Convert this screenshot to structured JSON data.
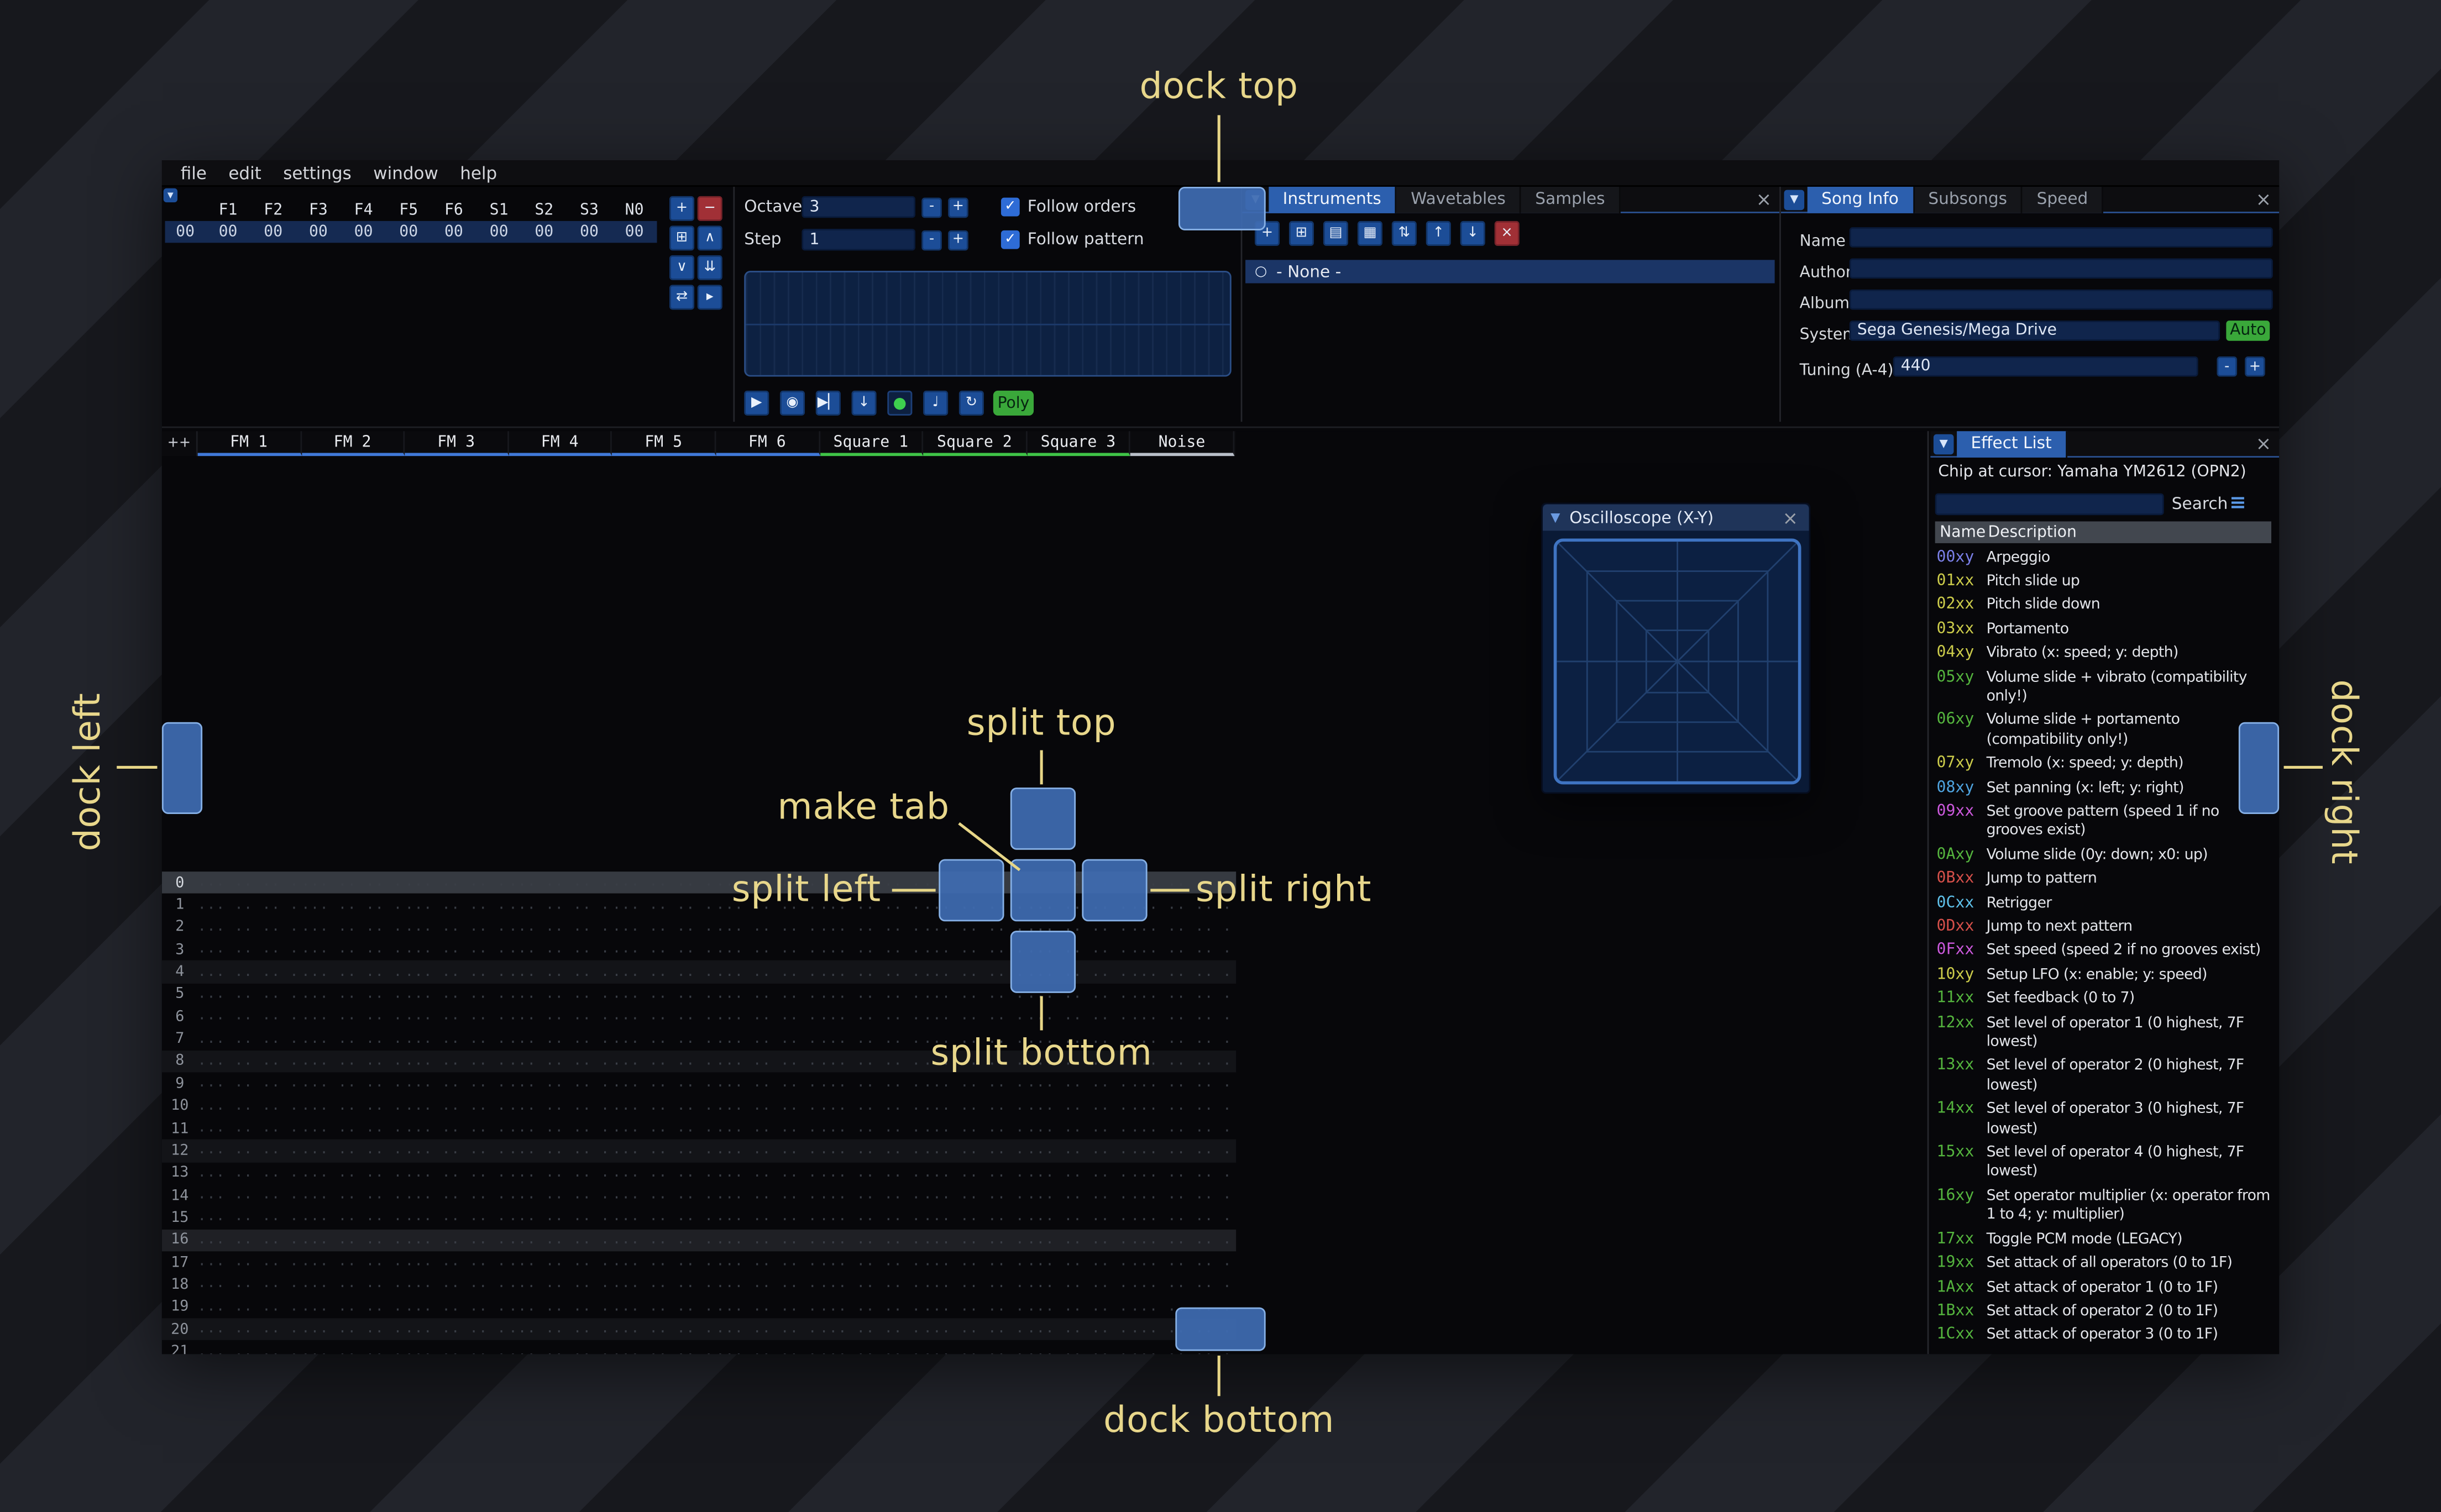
{
  "ui": {
    "minus": "-",
    "plus": "+",
    "check": "✓",
    "collapse": "▼",
    "close": "×",
    "menu": "≡",
    "radio": "○"
  },
  "window": {
    "menu": [
      "file",
      "edit",
      "settings",
      "window",
      "help"
    ]
  },
  "orders": {
    "channel_headers": [
      "F1",
      "F2",
      "F3",
      "F4",
      "F5",
      "F6",
      "S1",
      "S2",
      "S3",
      "N0"
    ],
    "rows": [
      {
        "index": "00",
        "cells": [
          "00",
          "00",
          "00",
          "00",
          "00",
          "00",
          "00",
          "00",
          "00",
          "00"
        ]
      }
    ],
    "buttons": [
      {
        "name": "add-order-button",
        "glyph": "+",
        "style": "blue"
      },
      {
        "name": "remove-order-button",
        "glyph": "−",
        "style": "red"
      },
      {
        "name": "duplicate-order-button",
        "glyph": "⊞",
        "style": "blue"
      },
      {
        "name": "move-order-up-button",
        "glyph": "∧",
        "style": "blue"
      },
      {
        "name": "move-order-down-button",
        "glyph": "∨",
        "style": "blue"
      },
      {
        "name": "deep-clone-order-button",
        "glyph": "⇊",
        "style": "blue"
      },
      {
        "name": "order-change-all-button",
        "glyph": "⇄",
        "style": "blue"
      },
      {
        "name": "order-edit-mode-button",
        "glyph": "▸",
        "style": "blue"
      }
    ]
  },
  "transport": {
    "octave": {
      "label": "Octave",
      "value": "3"
    },
    "step": {
      "label": "Step",
      "value": "1"
    },
    "follow_orders": "Follow orders",
    "follow_pattern": "Follow pattern",
    "poly_label": "Poly",
    "buttons": [
      {
        "name": "play-button",
        "glyph": "▶",
        "style": "blue"
      },
      {
        "name": "play-from-start-button",
        "glyph": "◉",
        "style": "blue"
      },
      {
        "name": "play-one-row-button",
        "glyph": "▶▏",
        "style": "blue"
      },
      {
        "name": "step-row-button",
        "glyph": "↓",
        "style": "blue"
      },
      {
        "name": "record-button",
        "glyph": "●",
        "style": "record"
      },
      {
        "name": "metronome-button",
        "glyph": "♩",
        "style": "blue"
      },
      {
        "name": "repeat-pattern-button",
        "glyph": "↻",
        "style": "blue"
      }
    ]
  },
  "instruments": {
    "tabs": [
      {
        "label": "Instruments",
        "active": true
      },
      {
        "label": "Wavetables",
        "active": false
      },
      {
        "label": "Samples",
        "active": false
      }
    ],
    "toolbar": [
      {
        "name": "add-instrument-button",
        "glyph": "+",
        "style": "blue"
      },
      {
        "name": "duplicate-instrument-button",
        "glyph": "⊞",
        "style": "blue"
      },
      {
        "name": "open-instrument-button",
        "glyph": "▤",
        "style": "blue"
      },
      {
        "name": "save-instrument-button",
        "glyph": "▦",
        "style": "blue"
      },
      {
        "name": "toggle-folders-button",
        "glyph": "⇅",
        "style": "blue"
      },
      {
        "name": "move-instrument-up-button",
        "glyph": "↑",
        "style": "blue"
      },
      {
        "name": "move-instrument-down-button",
        "glyph": "↓",
        "style": "blue"
      },
      {
        "name": "delete-instrument-button",
        "glyph": "×",
        "style": "red"
      }
    ],
    "list": [
      {
        "label": "- None -",
        "selected": true
      }
    ]
  },
  "song_info": {
    "tabs": [
      {
        "label": "Song Info",
        "active": true
      },
      {
        "label": "Subsongs",
        "active": false
      },
      {
        "label": "Speed",
        "active": false
      }
    ],
    "fields": [
      {
        "label": "Name",
        "value": ""
      },
      {
        "label": "Author",
        "value": ""
      },
      {
        "label": "Album",
        "value": ""
      }
    ],
    "system_label": "System",
    "system_value": "Sega Genesis/Mega Drive",
    "auto_label": "Auto",
    "tuning_label": "Tuning (A-4)",
    "tuning_value": "440"
  },
  "pattern": {
    "expand_label": "++",
    "channels": [
      {
        "name": "FM 1",
        "type": "fm"
      },
      {
        "name": "FM 2",
        "type": "fm"
      },
      {
        "name": "FM 3",
        "type": "fm"
      },
      {
        "name": "FM 4",
        "type": "fm"
      },
      {
        "name": "FM 5",
        "type": "fm"
      },
      {
        "name": "FM 6",
        "type": "fm"
      },
      {
        "name": "Square 1",
        "type": "square"
      },
      {
        "name": "Square 2",
        "type": "square"
      },
      {
        "name": "Square 3",
        "type": "square"
      },
      {
        "name": "Noise",
        "type": "noise"
      }
    ],
    "channel_colors": {
      "fm": "#4079d8",
      "square": "#3fc447",
      "noise": "#b9bfc9"
    },
    "visible_rows": 22,
    "current_row": 0,
    "row_highlight_minor": 4,
    "row_highlight_major": 16,
    "cell_placeholder": "... .. .. ...."
  },
  "oscilloscope": {
    "title": "Oscilloscope (X-Y)"
  },
  "effect_list": {
    "tab_label": "Effect List",
    "chip_line": "Chip at cursor: Yamaha YM2612 (OPN2)",
    "search_label": "Search",
    "columns": [
      "Name",
      "Description"
    ],
    "effects": [
      {
        "code": "00xy",
        "color": "#7b80e8",
        "desc": "Arpeggio"
      },
      {
        "code": "01xx",
        "color": "#cdcd4b",
        "desc": "Pitch slide up"
      },
      {
        "code": "02xx",
        "color": "#cdcd4b",
        "desc": "Pitch slide down"
      },
      {
        "code": "03xx",
        "color": "#cdcd4b",
        "desc": "Portamento"
      },
      {
        "code": "04xy",
        "color": "#cdcd4b",
        "desc": "Vibrato (x: speed; y: depth)"
      },
      {
        "code": "05xy",
        "color": "#55b53e",
        "desc": "Volume slide + vibrato (compatibility only!)"
      },
      {
        "code": "06xy",
        "color": "#55b53e",
        "desc": "Volume slide + portamento (compatibility only!)"
      },
      {
        "code": "07xy",
        "color": "#cdcd4b",
        "desc": "Tremolo (x: speed; y: depth)"
      },
      {
        "code": "08xy",
        "color": "#4fa4e0",
        "desc": "Set panning (x: left; y: right)"
      },
      {
        "code": "09xx",
        "color": "#cc59dd",
        "desc": "Set groove pattern (speed 1 if no grooves exist)"
      },
      {
        "code": "0Axy",
        "color": "#55b53e",
        "desc": "Volume slide (0y: down; x0: up)"
      },
      {
        "code": "0Bxx",
        "color": "#d6504a",
        "desc": "Jump to pattern"
      },
      {
        "code": "0Cxx",
        "color": "#5fc1ea",
        "desc": "Retrigger"
      },
      {
        "code": "0Dxx",
        "color": "#d6504a",
        "desc": "Jump to next pattern"
      },
      {
        "code": "0Fxx",
        "color": "#cc59dd",
        "desc": "Set speed (speed 2 if no grooves exist)"
      },
      {
        "code": "10xy",
        "color": "#cdcd4b",
        "desc": "Setup LFO (x: enable; y: speed)"
      },
      {
        "code": "11xx",
        "color": "#55b53e",
        "desc": "Set feedback (0 to 7)"
      },
      {
        "code": "12xx",
        "color": "#55b53e",
        "desc": "Set level of operator 1 (0 highest, 7F lowest)"
      },
      {
        "code": "13xx",
        "color": "#55b53e",
        "desc": "Set level of operator 2 (0 highest, 7F lowest)"
      },
      {
        "code": "14xx",
        "color": "#55b53e",
        "desc": "Set level of operator 3 (0 highest, 7F lowest)"
      },
      {
        "code": "15xx",
        "color": "#55b53e",
        "desc": "Set level of operator 4 (0 highest, 7F lowest)"
      },
      {
        "code": "16xy",
        "color": "#55b53e",
        "desc": "Set operator multiplier (x: operator from 1 to 4; y: multiplier)"
      },
      {
        "code": "17xx",
        "color": "#55b53e",
        "desc": "Toggle PCM mode (LEGACY)"
      },
      {
        "code": "19xx",
        "color": "#55b53e",
        "desc": "Set attack of all operators (0 to 1F)"
      },
      {
        "code": "1Axx",
        "color": "#55b53e",
        "desc": "Set attack of operator 1 (0 to 1F)"
      },
      {
        "code": "1Bxx",
        "color": "#55b53e",
        "desc": "Set attack of operator 2 (0 to 1F)"
      },
      {
        "code": "1Cxx",
        "color": "#55b53e",
        "desc": "Set attack of operator 3 (0 to 1F)"
      }
    ]
  },
  "overlay": {
    "accent_color": "#e8d78b",
    "dock_target_color": "#3e6cb2",
    "labels": {
      "dock_top": "dock top",
      "dock_bottom": "dock bottom",
      "dock_left": "dock left",
      "dock_right": "dock right",
      "split_top": "split top",
      "split_bottom": "split bottom",
      "split_left": "split left",
      "split_right": "split right",
      "make_tab": "make tab"
    }
  }
}
